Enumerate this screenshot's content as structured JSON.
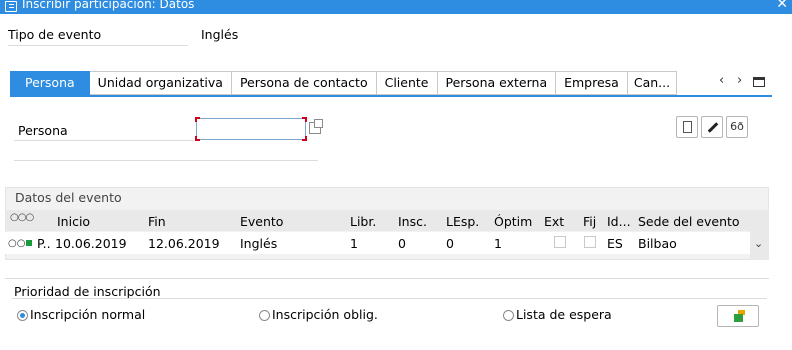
{
  "window": {
    "title": "Inscribir participación: Datos",
    "close": "✕"
  },
  "header": {
    "event_type_label": "Tipo de evento",
    "event_type_value": "Inglés"
  },
  "tabs": [
    {
      "label": "Persona",
      "active": true
    },
    {
      "label": "Unidad organizativa"
    },
    {
      "label": "Persona de contacto"
    },
    {
      "label": "Cliente"
    },
    {
      "label": "Persona externa"
    },
    {
      "label": "Empresa"
    },
    {
      "label": "Can..."
    }
  ],
  "tab_nav": {
    "prev": "‹",
    "next": "›"
  },
  "persona": {
    "label": "Persona",
    "value": ""
  },
  "toolbar_icons": [
    "new-document-icon",
    "edit-pencil-icon",
    "display-glasses-icon"
  ],
  "glasses_glyph": "6ð",
  "event_table": {
    "title": "Datos del evento",
    "columns": [
      "Inicio",
      "Fin",
      "Evento",
      "Libr.",
      "Insc.",
      "LEsp.",
      "Óptim",
      "Ext",
      "Fij",
      "Id...",
      "Sede del evento"
    ],
    "rows": [
      {
        "marker": "P..",
        "inicio": "10.06.2019",
        "fin": "12.06.2019",
        "evento": "Inglés",
        "libr": "1",
        "insc": "0",
        "lesp": "0",
        "optim": "1",
        "ext": false,
        "fij": false,
        "id": "ES",
        "sede": "Bilbao"
      }
    ]
  },
  "priority": {
    "title": "Prioridad de inscripción",
    "options": [
      {
        "label": "Inscripción normal",
        "selected": true
      },
      {
        "label": "Inscripción oblig.",
        "selected": false
      },
      {
        "label": "Lista de espera",
        "selected": false
      }
    ]
  },
  "colors": {
    "accent": "#2e8de0",
    "status_green": "#1a9a3a"
  }
}
